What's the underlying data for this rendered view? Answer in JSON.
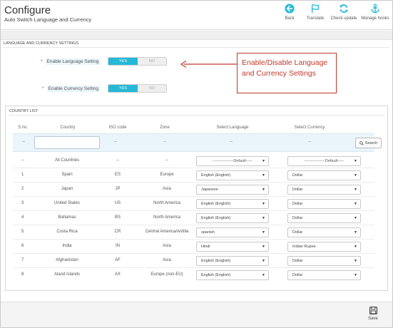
{
  "header": {
    "title": "Configure",
    "subtitle": "Auto Switch Language and Currency",
    "toolbar": [
      {
        "label": "Back",
        "icon": "back-arrow-icon"
      },
      {
        "label": "Translate",
        "icon": "flag-icon"
      },
      {
        "label": "Check update",
        "icon": "refresh-icon"
      },
      {
        "label": "Manage hooks",
        "icon": "anchor-icon"
      }
    ]
  },
  "settings": {
    "section_title": "LANGUAGE AND CURRENCY SETTINGS",
    "language": {
      "label": "Enable Language Setting",
      "yes": "YES",
      "no": "NO"
    },
    "currency": {
      "label": "Enable Currency Setting",
      "yes": "YES",
      "no": "NO"
    }
  },
  "callout": {
    "line1": "Enable/Disable Language",
    "line2": "and Currency Settings",
    "color": "#c0392b"
  },
  "country_list": {
    "title": "COUNTRY LIST",
    "columns": [
      "S.no.",
      "Country",
      "ISO code",
      "Zone",
      "Select Language",
      "Select Currency"
    ],
    "filter": {
      "dash": "--",
      "search_label": "Search"
    },
    "default_row": {
      "sno": "--",
      "country": "All Countries",
      "iso": "--",
      "zone": "--",
      "language": "----------------Default-----",
      "currency": "----------------Default-----"
    },
    "rows": [
      {
        "sno": "1",
        "country": "Spain",
        "iso": "ES",
        "zone": "Europe",
        "language": "English (English)",
        "currency": "Dollar"
      },
      {
        "sno": "2",
        "country": "Japan",
        "iso": "JP",
        "zone": "Asia",
        "language": "Japanese",
        "currency": "Dollar"
      },
      {
        "sno": "3",
        "country": "United States",
        "iso": "US",
        "zone": "North America",
        "language": "English (English)",
        "currency": "Dollar"
      },
      {
        "sno": "4",
        "country": "Bahamas",
        "iso": "BS",
        "zone": "North America",
        "language": "English (English)",
        "currency": "Dollar"
      },
      {
        "sno": "5",
        "country": "Costa Rica",
        "iso": "CR",
        "zone": "Central America/Antilla",
        "language": "spanish",
        "currency": "Dollar"
      },
      {
        "sno": "6",
        "country": "India",
        "iso": "IN",
        "zone": "Asia",
        "language": "Hindi",
        "currency": "Indian Rupee"
      },
      {
        "sno": "7",
        "country": "Afghanistan",
        "iso": "AF",
        "zone": "Asia",
        "language": "English (English)",
        "currency": "Dollar"
      },
      {
        "sno": "8",
        "country": "Aland Islands",
        "iso": "AX",
        "zone": "Europe (non-EU)",
        "language": "English (English)",
        "currency": "Dollar"
      }
    ]
  },
  "footer": {
    "save_label": "Save"
  },
  "colors": {
    "accent": "#25b9d7",
    "toolbar_icon": "#25b9d7",
    "filter_bg": "#eaf4fb"
  }
}
